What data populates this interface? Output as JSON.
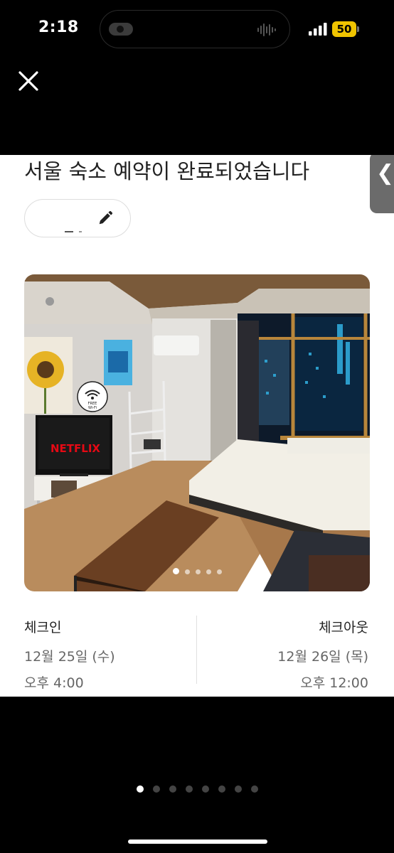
{
  "status": {
    "time": "2:18",
    "battery": "50"
  },
  "card": {
    "title": "서울 숙소 예약이 완료되었습니다",
    "photo_dots_total": 5,
    "photo_dots_active": 1
  },
  "photo": {
    "tv_text": "NETFLIX",
    "wifi_label_line1": "FREE",
    "wifi_label_line2": "Wi-Fi"
  },
  "checkin": {
    "label": "체크인",
    "date": "12월 25일 (수)",
    "time": "오후 4:00"
  },
  "checkout": {
    "label": "체크아웃",
    "date": "12월 26일 (목)",
    "time": "오후 12:00"
  },
  "pager": {
    "total": 8,
    "active": 1
  },
  "icons": {
    "close": "close-icon",
    "edit": "pencil-icon",
    "side": "chevron-left-icon"
  }
}
